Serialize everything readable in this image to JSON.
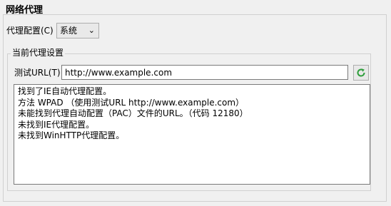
{
  "section_title": "网络代理",
  "proxy_config": {
    "label": "代理配置(C)",
    "selected": "系统",
    "dropdown_icon": "chevron-down-icon"
  },
  "current_settings": {
    "legend": "当前代理设置",
    "test_url": {
      "label": "测试URL(T)",
      "value": "http://www.example.com"
    },
    "refresh_icon": "refresh-icon",
    "refresh_color": "#2e9e3b",
    "results": [
      "找到了IE自动代理配置。",
      "方法 WPAD （使用测试URL http://www.example.com）",
      "未能找到代理自动配置（PAC）文件的URL。（代码 12180）",
      "未找到IE代理配置。",
      "未找到WinHTTP代理配置。"
    ]
  }
}
